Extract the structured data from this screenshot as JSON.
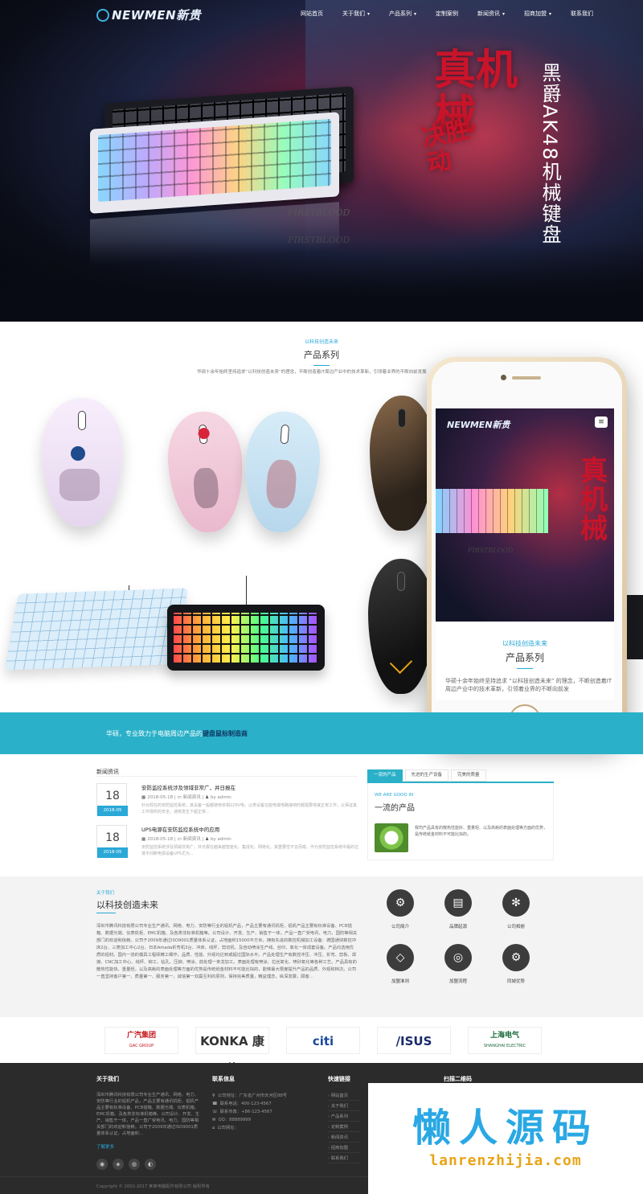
{
  "nav": {
    "logo": "NEWMEN新贵",
    "items": [
      {
        "label": "网站首页",
        "has_children": false
      },
      {
        "label": "关于我们",
        "has_children": true
      },
      {
        "label": "产品系列",
        "has_children": true
      },
      {
        "label": "定制案例",
        "has_children": false
      },
      {
        "label": "新闻资讯",
        "has_children": true
      },
      {
        "label": "招商加盟",
        "has_children": true
      },
      {
        "label": "联系我们",
        "has_children": false
      }
    ]
  },
  "hero": {
    "calligraphy": "真机械",
    "calligraphy_sub": "决胜动",
    "subtitle": "黑爵AK48机械键盘",
    "keyboard_brand": "FIRSTBLOOD"
  },
  "products": {
    "kicker": "以科技创造未来",
    "title": "产品系列",
    "description": "华硕十余年始终坚持追求“以科技创造未来”的理念，不断创造着IT周边产业中的技术革新，引领着业界的不断向前发展"
  },
  "phone": {
    "logo": "NEWMEN新贵",
    "menu_icon": "≡",
    "calligraphy": "真机械",
    "keyboard_brand": "FIRSTBLOOD",
    "kicker": "以科技创造未来",
    "title": "产品系列",
    "description": "华硕十余年始终坚持追求 “以科技创造未来” 的理念，不断创造着IT周边产业中的技术革新，引领着业界的不断向前发"
  },
  "banner": {
    "text_plain": "华硕，专业致力于电脑周边产品的",
    "text_bold": "键盘鼠标制造商"
  },
  "news": {
    "title": "新闻资讯",
    "items": [
      {
        "day": "18",
        "ym": "2018-05",
        "headline": "安防监控系统涉及领域非常广，并日报在",
        "date": "2018-05-18",
        "category": "新闻资讯",
        "author": "by admin",
        "excerpt": "针对现在的安防监控系统，其设备一般都使用单相220V电。以类设备在能电或电路接响时都需要将接正常工作，以保证其工作场所的安全。通常发生下超正常..."
      },
      {
        "day": "18",
        "ym": "2018-05",
        "headline": "UPS电源在安防监控系统中的应用",
        "date": "2018-05-18",
        "category": "新闻资讯",
        "author": "by admin",
        "excerpt": "安防监控系统涉及领域非常广，并日报在越来越智能化、集成化、网络化。其重要性不言而喻，作为安防监控系统中最的过境不间断电源设备UPS尤为..."
      }
    ]
  },
  "tabs": {
    "items": [
      "一流的产品",
      "先进的生产设备",
      "完美的质量"
    ],
    "active": 0,
    "panel": {
      "kicker": "WE ARE GOOD IN",
      "title": "一流的产品",
      "text": "我司产品具有的散热性能好、重量轻、以及高耗的表面处理等方面的优势，是传统纸金材料不可能比拟的。"
    }
  },
  "about": {
    "kicker": "关于我们",
    "title": "以科技创造未来",
    "text": "深圳市腾讯科技有限公司专业生产通讯、网络、电力、安防等行业的铝机产品，产品主要有通讯机柜、铝机产品主要有标准设备、PCB插箱、数据光端、仪表机柜、EMC机箱、及各类非标准机箱等。公司设计、开发、生产、销售于一体，产品一直广受电讯、电力、国防等相关部门的欢迎和信赖。公司于2009年通过ISO9001质量体系认证，占地面积15000平方米，拥有先进的数控机械加工设备：德国通快数控冲床2台、三菱加工中心2台、日本Amada折弯机3台、冲床、线杯、剪切机、及自动喷涂生产线、丝印、氧化一体成套设备。产品均选用优质的铝材。国内一流的模具工程师精工细作，品质、性能、外观均达到或超过国际水平。产品处理生产有数控冲压、冲压、折弯、剪板、焊接、CNC加工中心、线杯、铆工、钻孔、压铆、喷涂、前处理一条龙加工。表面处理有喷涂、拉丝氧化、喷砂氧化等各种工艺。产品具有的散热性能快、重量轻，以及高耗的表面处理等方面的优势是传统纸金材料不可能比拟的，能够最大限度提升产品的品质、外观和档次。公司一直坚持客户第一、质量第一、服务第一，诚信第一双赢互利的原则，保持完美质量，精益理念，纵深发展，顾客...",
    "features": [
      {
        "label": "公司简介",
        "icon": "gears-icon",
        "glyph": "⚙"
      },
      {
        "label": "品牌起源",
        "icon": "book-icon",
        "glyph": "▤"
      },
      {
        "label": "公司相册",
        "icon": "aperture-icon",
        "glyph": "✻"
      },
      {
        "label": "加盟准则",
        "icon": "diamond-icon",
        "glyph": "◇"
      },
      {
        "label": "加盟流程",
        "icon": "target-icon",
        "glyph": "◎"
      },
      {
        "label": "同城优势",
        "icon": "gears-icon",
        "glyph": "⚙"
      }
    ]
  },
  "partners": [
    {
      "name": "广汽集团",
      "sub": "GAC GROUP",
      "color": "#c4161c"
    },
    {
      "name": "KONKA 康佳",
      "sub": "",
      "color": "#333333"
    },
    {
      "name": "citi",
      "sub": "",
      "color": "#1a4a9c"
    },
    {
      "name": "/ISUS",
      "sub": "",
      "color": "#1a2a6c"
    },
    {
      "name": "上海电气",
      "sub": "SHANGHAI ELECTRIC",
      "color": "#1a6a3c"
    }
  ],
  "footer": {
    "about_title": "关于我们",
    "about_text": "深圳市腾讯科技有限公司专业生产通讯、网络、电力、安防等行业的铝机产品，产品主要有通讯机柜、铝机产品主要有标准设备、PCB插箱、数据光端、仪表机箱、EMC机箱、及各类非标准机箱等。公司设计、开发、生产、销售于一体，产品一直广受电讯、电力、国防等相关部门的欢迎和信赖。公司于2009年通过ISO9001质量体系认证，占地面积...",
    "more": "了解更多",
    "contact_title": "联系信息",
    "contact": [
      {
        "icon": "pin-icon",
        "glyph": "⚲",
        "text": "公司地址：广东省广州市天河区88号"
      },
      {
        "icon": "phone-icon",
        "glyph": "☎",
        "text": "联系电话：400-123-4567"
      },
      {
        "icon": "fax-icon",
        "glyph": "☏",
        "text": "联系传真：+86-123-4567"
      },
      {
        "icon": "qq-icon",
        "glyph": "✉",
        "text": "QQ：88889999"
      },
      {
        "icon": "web-icon",
        "glyph": "⌂",
        "text": "公司网址："
      }
    ],
    "quick_title": "快速链接",
    "quick_links": [
      "网站首页",
      "关于我们",
      "产品系列",
      "定制案例",
      "新闻资讯",
      "招商加盟",
      "联系我们"
    ],
    "qr_title": "扫描二维码",
    "copyright": "Copyright © 2002-2017 某某电脑配件有限公司 版权所有"
  },
  "watermark": {
    "big": "懒人源码",
    "small": "lanrenzhijia.com"
  },
  "colors": {
    "accent": "#2aa8d8",
    "banner": "#2ab0c8",
    "footer_bg": "#2b2b2b",
    "watermark_blue": "#2aa8e4",
    "watermark_orange": "#e8a417"
  }
}
